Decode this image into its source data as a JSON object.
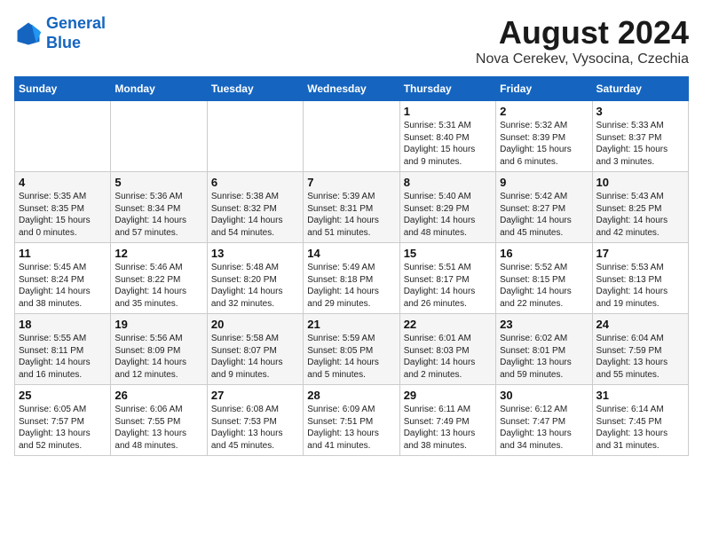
{
  "header": {
    "logo_line1": "General",
    "logo_line2": "Blue",
    "month_year": "August 2024",
    "location": "Nova Cerekev, Vysocina, Czechia"
  },
  "weekdays": [
    "Sunday",
    "Monday",
    "Tuesday",
    "Wednesday",
    "Thursday",
    "Friday",
    "Saturday"
  ],
  "weeks": [
    [
      {
        "day": "",
        "info": ""
      },
      {
        "day": "",
        "info": ""
      },
      {
        "day": "",
        "info": ""
      },
      {
        "day": "",
        "info": ""
      },
      {
        "day": "1",
        "info": "Sunrise: 5:31 AM\nSunset: 8:40 PM\nDaylight: 15 hours\nand 9 minutes."
      },
      {
        "day": "2",
        "info": "Sunrise: 5:32 AM\nSunset: 8:39 PM\nDaylight: 15 hours\nand 6 minutes."
      },
      {
        "day": "3",
        "info": "Sunrise: 5:33 AM\nSunset: 8:37 PM\nDaylight: 15 hours\nand 3 minutes."
      }
    ],
    [
      {
        "day": "4",
        "info": "Sunrise: 5:35 AM\nSunset: 8:35 PM\nDaylight: 15 hours\nand 0 minutes."
      },
      {
        "day": "5",
        "info": "Sunrise: 5:36 AM\nSunset: 8:34 PM\nDaylight: 14 hours\nand 57 minutes."
      },
      {
        "day": "6",
        "info": "Sunrise: 5:38 AM\nSunset: 8:32 PM\nDaylight: 14 hours\nand 54 minutes."
      },
      {
        "day": "7",
        "info": "Sunrise: 5:39 AM\nSunset: 8:31 PM\nDaylight: 14 hours\nand 51 minutes."
      },
      {
        "day": "8",
        "info": "Sunrise: 5:40 AM\nSunset: 8:29 PM\nDaylight: 14 hours\nand 48 minutes."
      },
      {
        "day": "9",
        "info": "Sunrise: 5:42 AM\nSunset: 8:27 PM\nDaylight: 14 hours\nand 45 minutes."
      },
      {
        "day": "10",
        "info": "Sunrise: 5:43 AM\nSunset: 8:25 PM\nDaylight: 14 hours\nand 42 minutes."
      }
    ],
    [
      {
        "day": "11",
        "info": "Sunrise: 5:45 AM\nSunset: 8:24 PM\nDaylight: 14 hours\nand 38 minutes."
      },
      {
        "day": "12",
        "info": "Sunrise: 5:46 AM\nSunset: 8:22 PM\nDaylight: 14 hours\nand 35 minutes."
      },
      {
        "day": "13",
        "info": "Sunrise: 5:48 AM\nSunset: 8:20 PM\nDaylight: 14 hours\nand 32 minutes."
      },
      {
        "day": "14",
        "info": "Sunrise: 5:49 AM\nSunset: 8:18 PM\nDaylight: 14 hours\nand 29 minutes."
      },
      {
        "day": "15",
        "info": "Sunrise: 5:51 AM\nSunset: 8:17 PM\nDaylight: 14 hours\nand 26 minutes."
      },
      {
        "day": "16",
        "info": "Sunrise: 5:52 AM\nSunset: 8:15 PM\nDaylight: 14 hours\nand 22 minutes."
      },
      {
        "day": "17",
        "info": "Sunrise: 5:53 AM\nSunset: 8:13 PM\nDaylight: 14 hours\nand 19 minutes."
      }
    ],
    [
      {
        "day": "18",
        "info": "Sunrise: 5:55 AM\nSunset: 8:11 PM\nDaylight: 14 hours\nand 16 minutes."
      },
      {
        "day": "19",
        "info": "Sunrise: 5:56 AM\nSunset: 8:09 PM\nDaylight: 14 hours\nand 12 minutes."
      },
      {
        "day": "20",
        "info": "Sunrise: 5:58 AM\nSunset: 8:07 PM\nDaylight: 14 hours\nand 9 minutes."
      },
      {
        "day": "21",
        "info": "Sunrise: 5:59 AM\nSunset: 8:05 PM\nDaylight: 14 hours\nand 5 minutes."
      },
      {
        "day": "22",
        "info": "Sunrise: 6:01 AM\nSunset: 8:03 PM\nDaylight: 14 hours\nand 2 minutes."
      },
      {
        "day": "23",
        "info": "Sunrise: 6:02 AM\nSunset: 8:01 PM\nDaylight: 13 hours\nand 59 minutes."
      },
      {
        "day": "24",
        "info": "Sunrise: 6:04 AM\nSunset: 7:59 PM\nDaylight: 13 hours\nand 55 minutes."
      }
    ],
    [
      {
        "day": "25",
        "info": "Sunrise: 6:05 AM\nSunset: 7:57 PM\nDaylight: 13 hours\nand 52 minutes."
      },
      {
        "day": "26",
        "info": "Sunrise: 6:06 AM\nSunset: 7:55 PM\nDaylight: 13 hours\nand 48 minutes."
      },
      {
        "day": "27",
        "info": "Sunrise: 6:08 AM\nSunset: 7:53 PM\nDaylight: 13 hours\nand 45 minutes."
      },
      {
        "day": "28",
        "info": "Sunrise: 6:09 AM\nSunset: 7:51 PM\nDaylight: 13 hours\nand 41 minutes."
      },
      {
        "day": "29",
        "info": "Sunrise: 6:11 AM\nSunset: 7:49 PM\nDaylight: 13 hours\nand 38 minutes."
      },
      {
        "day": "30",
        "info": "Sunrise: 6:12 AM\nSunset: 7:47 PM\nDaylight: 13 hours\nand 34 minutes."
      },
      {
        "day": "31",
        "info": "Sunrise: 6:14 AM\nSunset: 7:45 PM\nDaylight: 13 hours\nand 31 minutes."
      }
    ]
  ]
}
